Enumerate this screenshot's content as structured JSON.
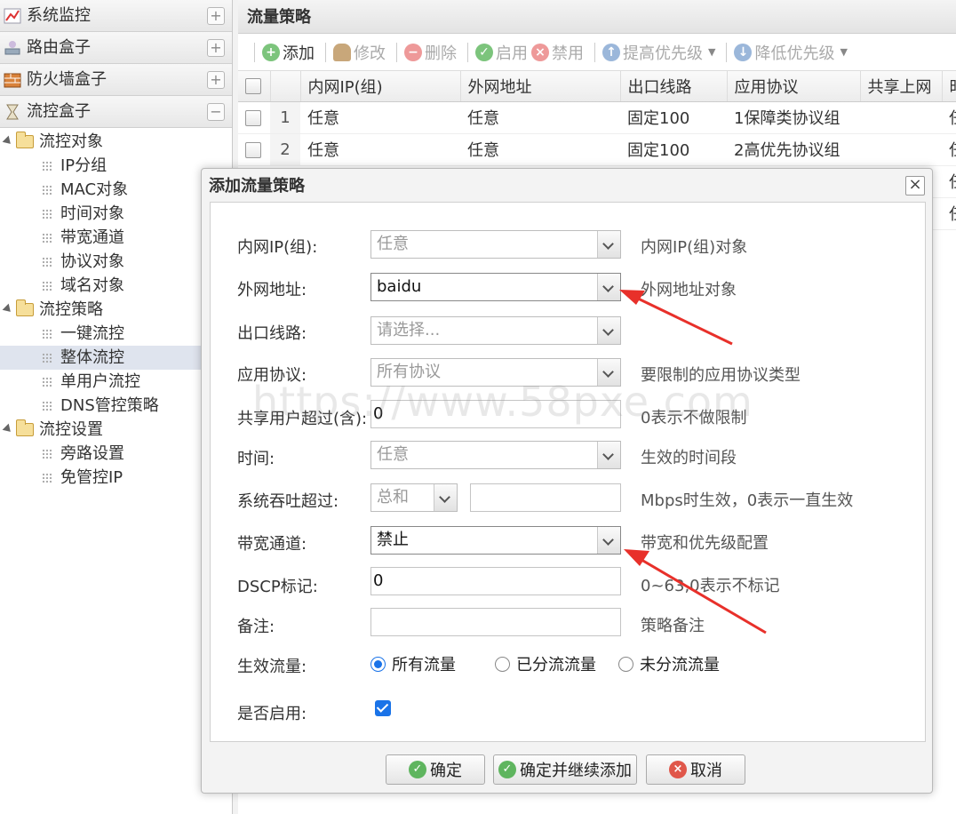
{
  "sidebar": {
    "sections": [
      {
        "label": "系统监控",
        "toggle": "+"
      },
      {
        "label": "路由盒子",
        "toggle": "+"
      },
      {
        "label": "防火墙盒子",
        "toggle": "+"
      },
      {
        "label": "流控盒子",
        "toggle": "−"
      }
    ],
    "tree": [
      {
        "label": "流控对象"
      },
      {
        "label": "IP分组"
      },
      {
        "label": "MAC对象"
      },
      {
        "label": "时间对象"
      },
      {
        "label": "带宽通道"
      },
      {
        "label": "协议对象"
      },
      {
        "label": "域名对象"
      },
      {
        "label": "流控策略"
      },
      {
        "label": "一键流控"
      },
      {
        "label": "整体流控"
      },
      {
        "label": "单用户流控"
      },
      {
        "label": "DNS管控策略"
      },
      {
        "label": "流控设置"
      },
      {
        "label": "旁路设置"
      },
      {
        "label": "免管控IP"
      }
    ]
  },
  "main": {
    "title": "流量策略",
    "toolbar": {
      "add": "添加",
      "edit": "修改",
      "delete": "删除",
      "enable": "启用",
      "disable": "禁用",
      "raise": "提高优先级",
      "lower": "降低优先级"
    },
    "columns": [
      "内网IP(组)",
      "外网地址",
      "出口线路",
      "应用协议",
      "共享上网",
      "时"
    ],
    "rows": [
      {
        "num": "1",
        "ip": "任意",
        "ext": "任意",
        "line": "固定100",
        "proto": "1保障类协议组",
        "share": "",
        "time": "任"
      },
      {
        "num": "2",
        "ip": "任意",
        "ext": "任意",
        "line": "固定100",
        "proto": "2高优先协议组",
        "share": "",
        "time": "任"
      }
    ],
    "hidden_rows_time": [
      "任",
      "任"
    ]
  },
  "dialog": {
    "title": "添加流量策略",
    "close": "×",
    "fields": {
      "ip": {
        "label": "内网IP(组):",
        "value": "任意",
        "hint": "内网IP(组)对象"
      },
      "ext": {
        "label": "外网地址:",
        "value": "baidu",
        "hint": "外网地址对象"
      },
      "line": {
        "label": "出口线路:",
        "value": "请选择..."
      },
      "proto": {
        "label": "应用协议:",
        "value": "所有协议",
        "hint": "要限制的应用协议类型"
      },
      "share": {
        "label": "共享用户超过(含):",
        "value": "0",
        "hint": "0表示不做限制"
      },
      "time": {
        "label": "时间:",
        "value": "任意",
        "hint": "生效的时间段"
      },
      "thru": {
        "label": "系统吞吐超过:",
        "select": "总和",
        "value": "",
        "hint": "Mbps时生效，0表示一直生效"
      },
      "bw": {
        "label": "带宽通道:",
        "value": "禁止",
        "hint": "带宽和优先级配置"
      },
      "dscp": {
        "label": "DSCP标记:",
        "value": "0",
        "hint": "0~63,0表示不标记"
      },
      "note": {
        "label": "备注:",
        "value": "",
        "hint": "策略备注"
      },
      "flow": {
        "label": "生效流量:",
        "options": [
          "所有流量",
          "已分流流量",
          "未分流流量"
        ],
        "selected": "所有流量"
      },
      "enabled": {
        "label": "是否启用:",
        "checked": true
      }
    },
    "buttons": {
      "ok": "确定",
      "ok_more": "确定并继续添加",
      "cancel": "取消"
    }
  },
  "watermark": "https://www.58pxe.com",
  "colors": {
    "accent": "#1a73e8",
    "arrow": "#e8302a"
  }
}
